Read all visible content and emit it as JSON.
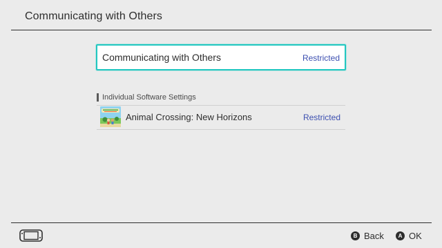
{
  "header": {
    "title": "Communicating with Others"
  },
  "main_option": {
    "label": "Communicating with Others",
    "value": "Restricted"
  },
  "section": {
    "heading": "Individual Software Settings"
  },
  "software": [
    {
      "name": "Animal Crossing: New Horizons",
      "value": "Restricted",
      "icon": "animal-crossing-game-icon"
    }
  ],
  "footer": {
    "console_icon": "handheld-console-icon",
    "buttons": [
      {
        "glyph": "B",
        "label": "Back"
      },
      {
        "glyph": "A",
        "label": "OK"
      }
    ]
  },
  "colors": {
    "background": "#ebebeb",
    "text": "#2d2d2d",
    "accent_focus": "#22c7c0",
    "value_blue": "#3c4fb0"
  }
}
